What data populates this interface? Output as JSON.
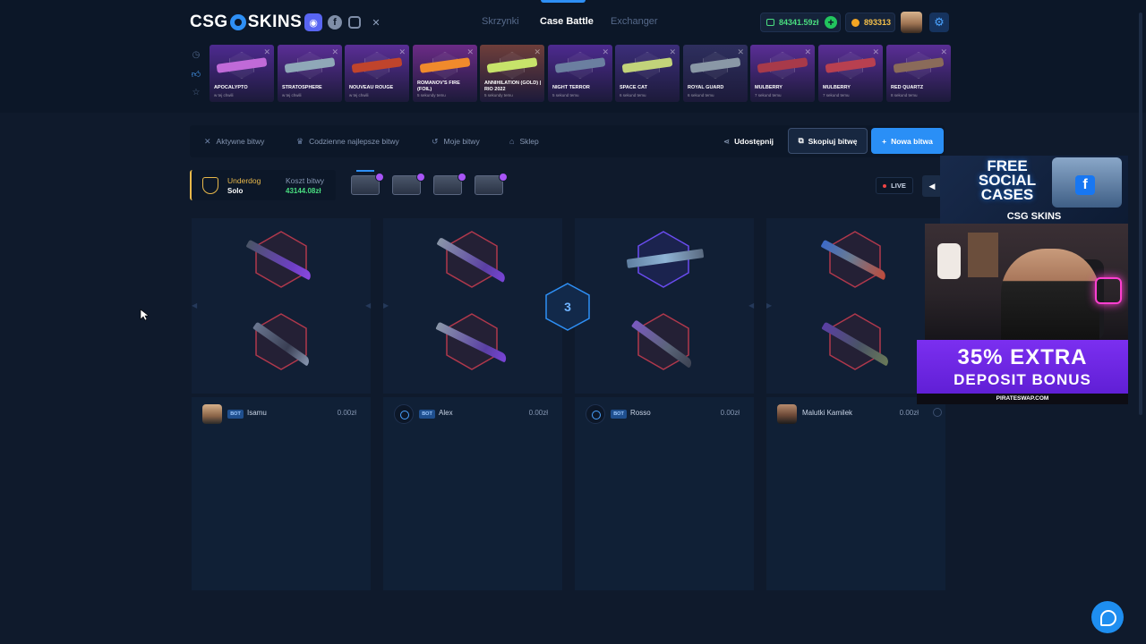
{
  "header": {
    "logo_left": "CSG",
    "logo_right": "SKINS",
    "nav": [
      "Skrzynki",
      "Case Battle",
      "Exchanger"
    ],
    "active_nav": "Case Battle",
    "balance": "84341.59zł",
    "coins": "893313"
  },
  "drops": [
    {
      "name": "APOCALYPTO",
      "time": "w tej chwili",
      "bg": "#4d2a8f",
      "gun": "#c06ad8"
    },
    {
      "name": "STRATOSPHERE",
      "time": "w tej chwili",
      "bg": "#5a2e96",
      "gun": "#8fa8b8"
    },
    {
      "name": "NOUVEAU ROUGE",
      "time": "w tej chwili",
      "bg": "#5a2e96",
      "gun": "#c0442c"
    },
    {
      "name": "ROMANOV'S FIRE (FOIL)",
      "time": "5 sekundy temu",
      "bg": "#6b2b86",
      "gun": "#f08a2c"
    },
    {
      "name": "ANNIHILATION (GOLD) | RIO 2022",
      "time": "5 sekundy temu",
      "bg": "#6e3e3a",
      "gun": "#c7e36a"
    },
    {
      "name": "NIGHT TERROR",
      "time": "5 sekund temu",
      "bg": "#4d2a8f",
      "gun": "#6b7fa0"
    },
    {
      "name": "SPACE CAT",
      "time": "6 sekund temu",
      "bg": "#3c2e7a",
      "gun": "#c2d37a"
    },
    {
      "name": "ROYAL GUARD",
      "time": "6 sekund temu",
      "bg": "#2e2f5e",
      "gun": "#8a98a6"
    },
    {
      "name": "MULBERRY",
      "time": "7 sekund temu",
      "bg": "#5a2e96",
      "gun": "#a83a4a"
    },
    {
      "name": "MULBERRY",
      "time": "7 sekund temu",
      "bg": "#5a2e96",
      "gun": "#b84050"
    },
    {
      "name": "RED QUARTZ",
      "time": "8 sekund temu",
      "bg": "#5a2e96",
      "gun": "#8a6b5a"
    }
  ],
  "toolbar": {
    "active_battles": "Aktywne bitwy",
    "daily_best": "Codzienne najlepsze bitwy",
    "my_battles": "Moje bitwy",
    "shop": "Sklep",
    "share": "Udostępnij",
    "copy": "Skopiuj bitwę",
    "new": "Nowa bitwa"
  },
  "battle": {
    "mode": "Underdog",
    "type": "Solo",
    "cost_label": "Koszt bitwy",
    "cost": "43144.08zł",
    "live": "LIVE",
    "round": "3"
  },
  "players": [
    {
      "name": "Isamu",
      "value": "0.00zł",
      "bot": true,
      "avatar": "photo"
    },
    {
      "name": "Alex",
      "value": "0.00zł",
      "bot": true,
      "avatar": "bot"
    },
    {
      "name": "Rosso",
      "value": "0.00zł",
      "bot": true,
      "avatar": "bot"
    },
    {
      "name": "Malutki Kamilek",
      "value": "0.00zł",
      "bot": false,
      "avatar": "photo"
    }
  ],
  "bot_tag": "BOT",
  "stream": {
    "free_line1": "FREE",
    "free_line2": "SOCIAL",
    "free_line3": "CASES",
    "brand": "CSG SKINS",
    "bonus_line1": "35% EXTRA",
    "bonus_line2": "DEPOSIT BONUS",
    "bonus_site": "PIRATESWAP.COM"
  },
  "colors": {
    "accent": "#2a8ff6",
    "green": "#4ade80",
    "gold": "#e8b84a",
    "purple": "#a855f7"
  }
}
